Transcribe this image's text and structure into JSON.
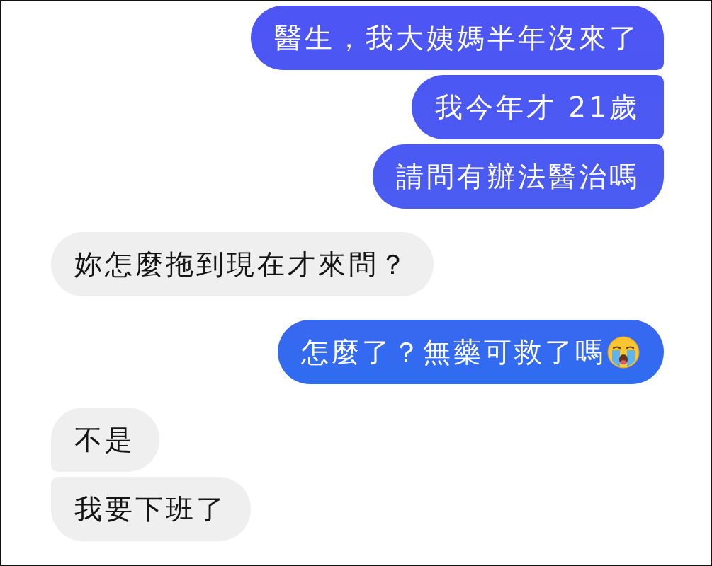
{
  "groups": [
    {
      "kind": "sent",
      "messages": [
        {
          "text": "醫生，我大姨媽半年沒來了",
          "emoji": false
        },
        {
          "text": "我今年才 21歲",
          "emoji": false
        },
        {
          "text": "請問有辦法醫治嗎",
          "emoji": false
        }
      ]
    },
    {
      "kind": "received",
      "messages": [
        {
          "text": "妳怎麼拖到現在才來問？",
          "emoji": false
        }
      ]
    },
    {
      "kind": "sent",
      "messages": [
        {
          "text": "怎麼了？無藥可救了嗎",
          "emoji": true
        }
      ]
    },
    {
      "kind": "received",
      "messages": [
        {
          "text": "不是",
          "emoji": false
        },
        {
          "text": "我要下班了",
          "emoji": false
        }
      ]
    }
  ]
}
